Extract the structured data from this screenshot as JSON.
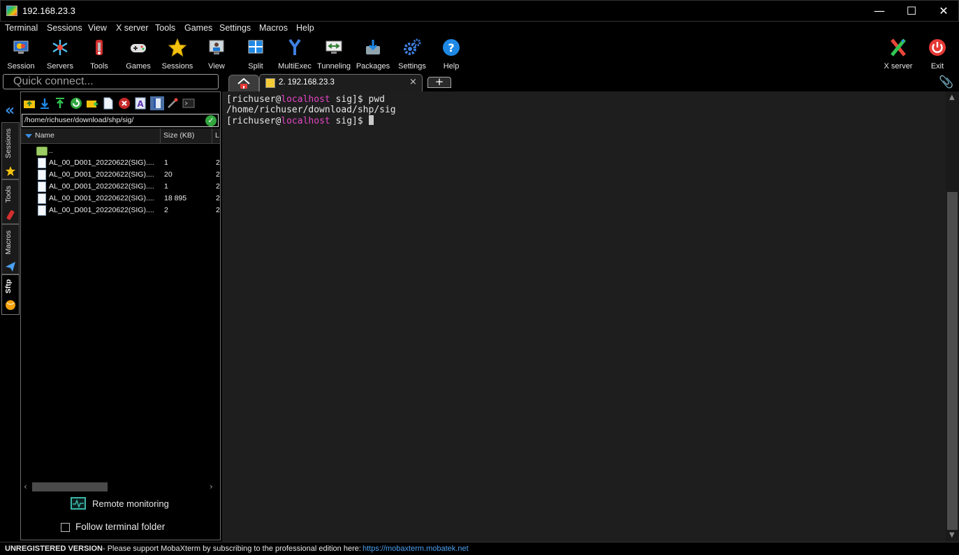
{
  "window": {
    "title": "192.168.23.3",
    "minimize": "—",
    "maximize": "☐",
    "close": "✕"
  },
  "menu": [
    "Terminal",
    "Sessions",
    "View",
    "X server",
    "Tools",
    "Games",
    "Settings",
    "Macros",
    "Help"
  ],
  "toolbar": {
    "session": "Session",
    "servers": "Servers",
    "tools": "Tools",
    "games": "Games",
    "sessions": "Sessions",
    "view": "View",
    "split": "Split",
    "multiexec": "MultiExec",
    "tunneling": "Tunneling",
    "packages": "Packages",
    "settings": "Settings",
    "help": "Help",
    "xserver": "X server",
    "exit": "Exit"
  },
  "quick_connect": {
    "placeholder": "Quick connect..."
  },
  "tabs": {
    "session_tab": "2. 192.168.23.3",
    "close": "×",
    "new": "+"
  },
  "side_tabs": {
    "sessions": "Sessions",
    "tools": "Tools",
    "macros": "Macros",
    "sftp": "Sftp"
  },
  "sftp": {
    "path": "/home/richuser/download/shp/sig/",
    "columns": {
      "name": "Name",
      "size": "Size (KB)",
      "last": "L"
    },
    "parent": "..",
    "files": [
      {
        "name": "AL_00_D001_20220622(SIG)....",
        "size": "1",
        "ext": "2"
      },
      {
        "name": "AL_00_D001_20220622(SIG)....",
        "size": "20",
        "ext": "2"
      },
      {
        "name": "AL_00_D001_20220622(SIG)....",
        "size": "1",
        "ext": "2"
      },
      {
        "name": "AL_00_D001_20220622(SIG)....",
        "size": "18 895",
        "ext": "2"
      },
      {
        "name": "AL_00_D001_20220622(SIG)....",
        "size": "2",
        "ext": "2"
      }
    ],
    "remote_monitoring": "Remote monitoring",
    "follow_terminal": "Follow terminal folder"
  },
  "terminal": {
    "line1_pre": "[richuser@",
    "line1_host": "localhost",
    "line1_post": " sig]$ pwd",
    "line2": "/home/richuser/download/shp/sig",
    "line3_pre": "[richuser@",
    "line3_host": "localhost",
    "line3_post": " sig]$ "
  },
  "status": {
    "unregistered": "UNREGISTERED VERSION",
    "message": "-  Please support MobaXterm by subscribing to the professional edition here:",
    "link": "https://mobaxterm.mobatek.net"
  },
  "colors": {
    "accent": "#3a8de0",
    "host": "#e546c6",
    "terminal_bg": "#1e1e1e"
  }
}
